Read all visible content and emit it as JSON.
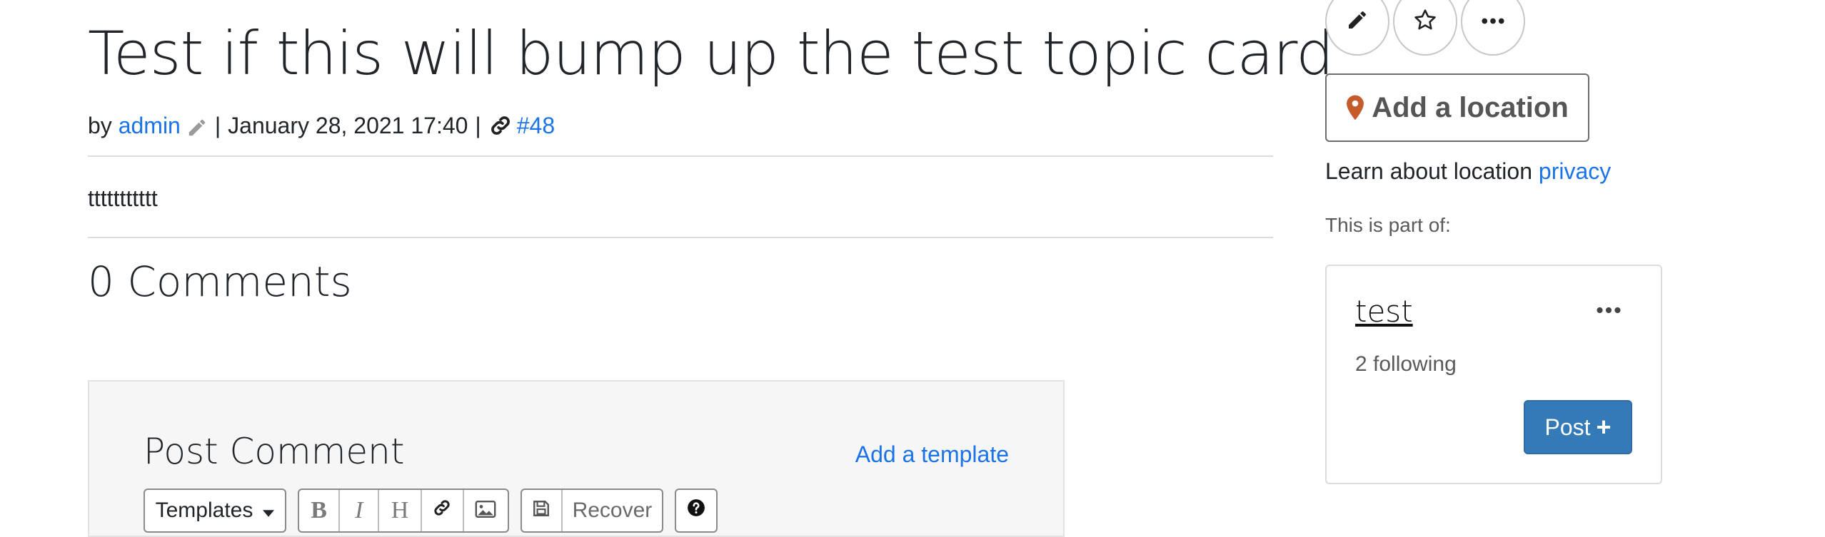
{
  "topic": {
    "title": "Test if this will bump up the test topic card",
    "by_prefix": "by",
    "author": "admin",
    "separator": "|",
    "date": "January 28, 2021 17:40",
    "id_link": "#48",
    "body": "ttttttttttt",
    "comments_heading": "0 Comments"
  },
  "comment_form": {
    "title": "Post Comment",
    "add_template": "Add a template",
    "templates_label": "Templates",
    "bold": "B",
    "italic": "I",
    "heading": "H",
    "recover_label": "Recover"
  },
  "sidebar": {
    "add_location": "Add a location",
    "learn_prefix": "Learn about location",
    "privacy_link": "privacy",
    "part_of": "This is part of:",
    "card": {
      "title": "test",
      "following": "2 following",
      "post_label": "Post",
      "post_plus": "+"
    }
  },
  "colors": {
    "link": "#1a73e8",
    "primary_button": "#337ab7",
    "location_pin": "#c55a2a"
  },
  "icons": [
    "pencil-icon",
    "star-icon",
    "more-icon",
    "chain-link-icon",
    "map-pin-icon",
    "image-icon",
    "save-icon",
    "help-icon",
    "caret-down-icon"
  ]
}
